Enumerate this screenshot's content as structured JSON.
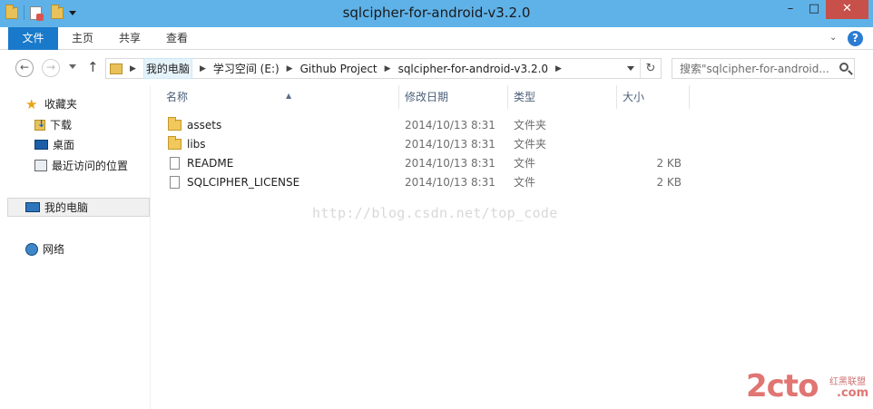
{
  "window": {
    "title": "sqlcipher-for-android-v3.2.0",
    "controls": {
      "minimize": "–",
      "maximize": "□",
      "close": "✕"
    }
  },
  "ribbon": {
    "tabs": [
      {
        "label": "文件"
      },
      {
        "label": "主页"
      },
      {
        "label": "共享"
      },
      {
        "label": "查看"
      }
    ],
    "help": "?"
  },
  "navigation": {
    "breadcrumbs": [
      {
        "label": "我的电脑"
      },
      {
        "label": "学习空间 (E:)"
      },
      {
        "label": "Github Project"
      },
      {
        "label": "sqlcipher-for-android-v3.2.0"
      }
    ],
    "search_placeholder": "搜索\"sqlcipher-for-android...",
    "icons": {
      "back": "back-arrow-icon",
      "forward": "forward-arrow-icon",
      "up": "up-arrow-icon",
      "refresh": "refresh-icon",
      "search": "search-icon"
    }
  },
  "sidebar": {
    "favorites": {
      "label": "收藏夹",
      "items": [
        {
          "label": "下载"
        },
        {
          "label": "桌面"
        },
        {
          "label": "最近访问的位置"
        }
      ]
    },
    "this_pc": "我的电脑",
    "network": "网络"
  },
  "columns": {
    "name": "名称",
    "date": "修改日期",
    "type": "类型",
    "size": "大小"
  },
  "files": [
    {
      "name": "assets",
      "date": "2014/10/13 8:31",
      "type": "文件夹",
      "size": "",
      "kind": "folder"
    },
    {
      "name": "libs",
      "date": "2014/10/13 8:31",
      "type": "文件夹",
      "size": "",
      "kind": "folder"
    },
    {
      "name": "README",
      "date": "2014/10/13 8:31",
      "type": "文件",
      "size": "2 KB",
      "kind": "file"
    },
    {
      "name": "SQLCIPHER_LICENSE",
      "date": "2014/10/13 8:31",
      "type": "文件",
      "size": "2 KB",
      "kind": "file"
    }
  ],
  "watermark": "http://blog.csdn.net/top_code",
  "logo": {
    "main": "2cto",
    "sub": "红黑联盟",
    "domain": ".com"
  }
}
